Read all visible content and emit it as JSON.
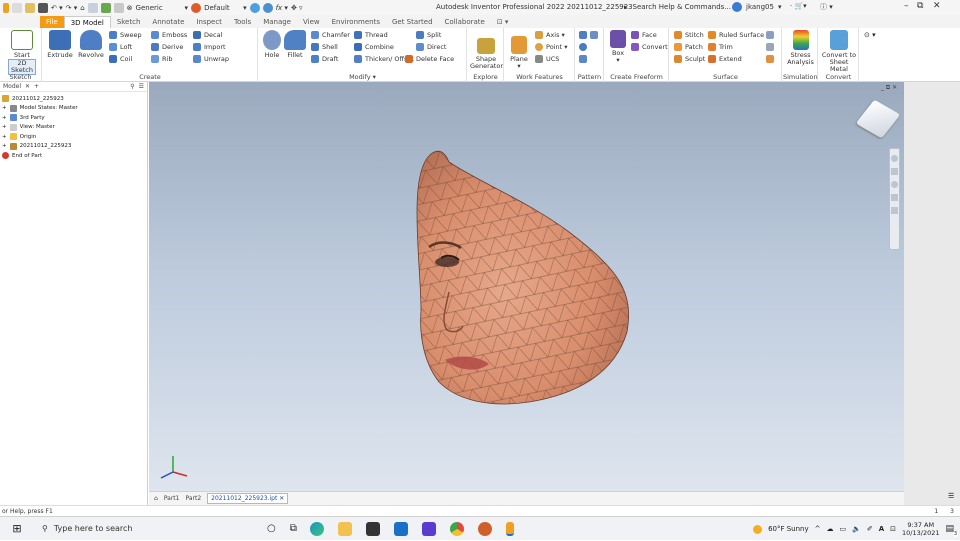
{
  "app": {
    "title": "Autodesk Inventor Professional 2022   20211012_225923",
    "search_placeholder": "Search Help & Commands...",
    "user": "jkang05",
    "quick_access": {
      "material": "Generic",
      "appearance": "Default"
    }
  },
  "tabs": [
    "File",
    "3D Model",
    "Sketch",
    "Annotate",
    "Inspect",
    "Tools",
    "Manage",
    "View",
    "Environments",
    "Get Started",
    "Collaborate"
  ],
  "active_tab": "3D Model",
  "ribbon": {
    "sketch": {
      "label": "Sketch",
      "start": "Start",
      "start2": "2D Sketch"
    },
    "create": {
      "label": "Create",
      "extrude": "Extrude",
      "revolve": "Revolve",
      "sweep": "Sweep",
      "emboss": "Emboss",
      "decal": "Decal",
      "loft": "Loft",
      "derive": "Derive",
      "import": "Import",
      "coil": "Coil",
      "rib": "Rib",
      "unwrap": "Unwrap"
    },
    "modify": {
      "label": "Modify ▾",
      "hole": "Hole",
      "fillet": "Fillet",
      "chamfer": "Chamfer",
      "thread": "Thread",
      "split": "Split",
      "shell": "Shell",
      "combine": "Combine",
      "direct": "Direct",
      "draft": "Draft",
      "thicken": "Thicken/ Offset",
      "delete_face": "Delete Face"
    },
    "explore": {
      "label": "Explore",
      "shape_gen": "Shape",
      "shape_gen2": "Generator"
    },
    "work_features": {
      "label": "Work Features",
      "plane": "Plane",
      "axis": "Axis ▾",
      "point": "Point ▾",
      "ucs": "UCS"
    },
    "pattern": {
      "label": "Pattern"
    },
    "freeform": {
      "label": "Create Freeform",
      "box": "Box",
      "face": "Face",
      "convert": "Convert"
    },
    "surface": {
      "label": "Surface",
      "stitch": "Stitch",
      "ruled": "Ruled Surface",
      "patch": "Patch",
      "trim": "Trim",
      "sculpt": "Sculpt",
      "extend": "Extend"
    },
    "simulation": {
      "label": "Simulation",
      "stress": "Stress",
      "stress2": "Analysis"
    },
    "convert": {
      "label": "Convert",
      "sheet": "Convert to",
      "sheet2": "Sheet Metal"
    }
  },
  "browser": {
    "header": "Model",
    "nodes": [
      "20211012_225923",
      "Model States: Master",
      "3rd Party",
      "View: Master",
      "Origin",
      "20211012_225923",
      "End of Part"
    ]
  },
  "doc_tabs": [
    "Part1",
    "Part2",
    "20211012_225923.ipt"
  ],
  "status": {
    "left": "or Help, press F1",
    "right1": "1",
    "right2": "3"
  },
  "taskbar": {
    "search": "Type here to search",
    "weather": "60°F  Sunny",
    "time": "9:37 AM",
    "date": "10/13/2021",
    "notif": "3"
  }
}
